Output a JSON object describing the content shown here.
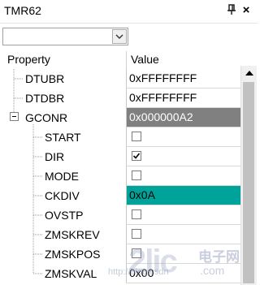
{
  "window": {
    "title": "TMR62",
    "pin_icon": "pin-icon",
    "close_glyph": "×"
  },
  "combobox": {
    "value": "",
    "icon": "chevron-down-icon"
  },
  "grid": {
    "headers": {
      "property": "Property",
      "value": "Value"
    },
    "rows": [
      {
        "name": "DTUBR",
        "value": "0xFFFFFFFF",
        "type": "text",
        "level": 0
      },
      {
        "name": "DTDBR",
        "value": "0xFFFFFFFF",
        "type": "text",
        "level": 0
      },
      {
        "name": "GCONR",
        "value": "0x000000A2",
        "type": "group",
        "expanded": true,
        "expander": "⊟",
        "level": 0
      },
      {
        "name": "START",
        "value": "",
        "type": "checkbox",
        "checked": false,
        "level": 1
      },
      {
        "name": "DIR",
        "value": "",
        "type": "checkbox",
        "checked": true,
        "level": 1
      },
      {
        "name": "MODE",
        "value": "",
        "type": "checkbox",
        "checked": false,
        "level": 1
      },
      {
        "name": "CKDIV",
        "value": "0x0A",
        "type": "text",
        "highlight": "#00A39A",
        "level": 1
      },
      {
        "name": "OVSTP",
        "value": "",
        "type": "checkbox",
        "checked": false,
        "level": 1
      },
      {
        "name": "ZMSKREV",
        "value": "",
        "type": "checkbox",
        "checked": false,
        "level": 1
      },
      {
        "name": "ZMSKPOS",
        "value": "",
        "type": "checkbox",
        "checked": false,
        "level": 1
      },
      {
        "name": "ZMSKVAL",
        "value": "0x00",
        "type": "text",
        "level": 1
      }
    ]
  },
  "scrollbar": {
    "up_icon": "scroll-up-arrow-icon"
  },
  "watermark": {
    "url_text": "http://blog.csdn",
    "logo": "2lic",
    "cn": "电子网",
    "com": ".com"
  },
  "colors": {
    "selected_bg": "#808080",
    "teal_bg": "#00A39A"
  }
}
